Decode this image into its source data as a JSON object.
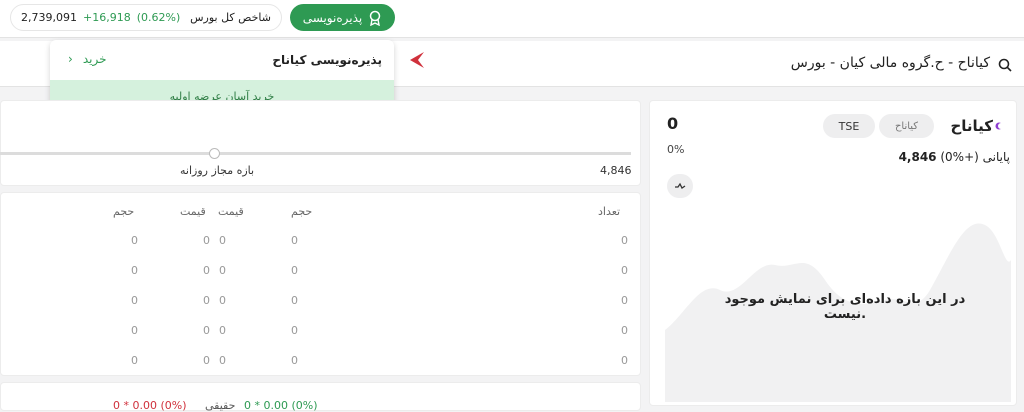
{
  "topbar": {
    "subscribe_button": "پذیره‌نویسی",
    "index": {
      "value": "2,739,091",
      "change": "+16,918",
      "percent": "(0.62%)",
      "label": "شاخص کل بورس"
    }
  },
  "search": {
    "title": "کیاناح - ح.گروه مالی کیان - بورس"
  },
  "dropdown": {
    "title": "پذیره‌نویسی کیاناح",
    "buy_label": "خرید",
    "chevron": "›",
    "banner": "خرید آسان عرضه اولیه"
  },
  "symbol": {
    "name": "کیاناح",
    "market_badge": "TSE",
    "last_price": "0",
    "last_percent": "0%",
    "status_label": "پایانی",
    "status_pct": "(0%+)",
    "status_value": "4,846",
    "no_data": "در این بازه داده‌ای برای نمایش موجود نیست."
  },
  "range": {
    "label": "بازه مجاز روزانه",
    "value": "4,846"
  },
  "orderbook": {
    "headers": {
      "count": "تعداد",
      "buy_volume": "حجم",
      "buy_price": "قیمت",
      "sell_price": "قیمت",
      "sell_volume": "حجم"
    },
    "rows": [
      {
        "count": "0",
        "bvol": "0",
        "bprice": "0",
        "sprice": "0",
        "svol": "0"
      },
      {
        "count": "0",
        "bvol": "0",
        "bprice": "0",
        "sprice": "0",
        "svol": "0"
      },
      {
        "count": "0",
        "bvol": "0",
        "bprice": "0",
        "sprice": "0",
        "svol": "0"
      },
      {
        "count": "0",
        "bvol": "0",
        "bprice": "0",
        "sprice": "0",
        "svol": "0"
      },
      {
        "count": "0",
        "bvol": "0",
        "bprice": "0",
        "sprice": "0",
        "svol": "0"
      }
    ]
  },
  "bottom": {
    "left": "0 * 0.00 (0%)",
    "mid": "حقیقی",
    "right": "0 * 0.00 (0%)"
  },
  "colors": {
    "accent_green": "#2e9a53",
    "red": "#d0313c"
  }
}
